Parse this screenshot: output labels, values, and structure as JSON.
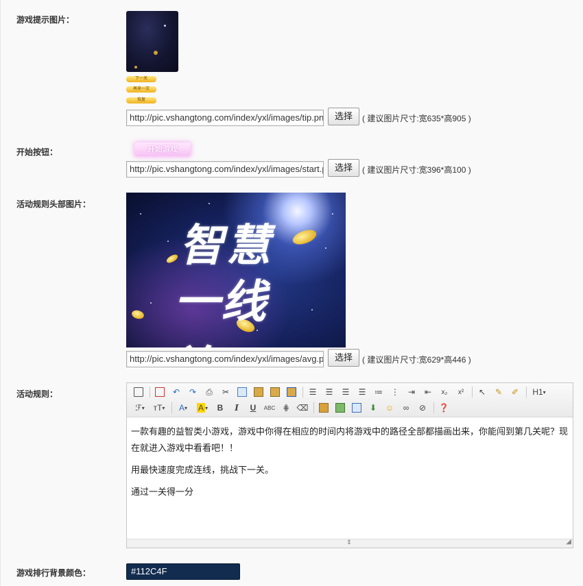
{
  "form": {
    "tip_image": {
      "label": "游戏提示图片：",
      "url": "http://pic.vshangtong.com/index/yxl/images/tip.png",
      "select_label": "选择",
      "hint": "( 建议图片尺寸:宽635*高905 )",
      "preview_buttons": [
        "下一关",
        "再来一次",
        "恢复"
      ]
    },
    "start_button": {
      "label": "开始按钮：",
      "preview_text": "开始游戏",
      "url": "http://pic.vshangtong.com/index/yxl/images/start.png",
      "select_label": "选择",
      "hint": "( 建议图片尺寸:宽396*高100 )"
    },
    "rules_header_image": {
      "label": "活动规则头部图片：",
      "image_text_line1": "智慧",
      "image_text_line2": "一线连",
      "url": "http://pic.vshangtong.com/index/yxl/images/avg.png",
      "select_label": "选择",
      "hint": "( 建议图片尺寸:宽629*高446 )"
    },
    "rules": {
      "label": "活动规则：",
      "paragraphs": [
        "一款有趣的益智类小游戏，游戏中你得在相应的时间内将游戏中的路径全部都描画出来，你能闯到第几关呢？现在就进入游戏中看看吧！！",
        "用最快速度完成连线，挑战下一关。",
        "通过一关得一分"
      ],
      "toolbar": {
        "heading_label": "H1",
        "font_label": "ℱ",
        "size_label": "ᴛT",
        "font_color_label": "A",
        "highlight_label": "A",
        "bold_label": "B",
        "italic_label": "I",
        "underline_label": "U",
        "strike_label": "ABC",
        "subscript_label": "x₂",
        "superscript_label": "x²"
      }
    },
    "rank_bg_color": {
      "label": "游戏排行背景颜色：",
      "value": "#112C4F"
    }
  },
  "colors": {
    "rank_bg": "#112C4F",
    "button_gold": "#f0b21e",
    "start_pink": "#f6c2f4"
  }
}
